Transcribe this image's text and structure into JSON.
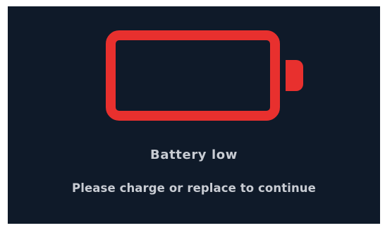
{
  "icon": {
    "name": "battery-empty-icon",
    "color": "#e8302e",
    "level": 0
  },
  "screen": {
    "background": "#0f1a29",
    "title": "Battery low",
    "message": "Please charge or replace to continue"
  }
}
